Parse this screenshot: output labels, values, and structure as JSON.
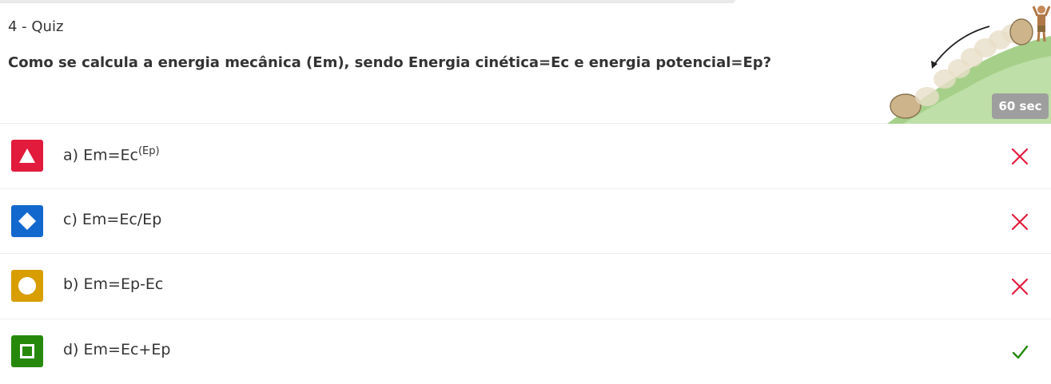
{
  "quiz": {
    "label": "4 - Quiz",
    "question": "Como se calcula a energia mecânica (Em), sendo Energia cinética=Ec e energia potencial=Ep?",
    "timer": "60 sec"
  },
  "answers": [
    {
      "prefix": "a) Em=Ec",
      "sup": "(Ep)",
      "shape": "triangle-icon",
      "color": "#e21b3c",
      "result": "incorrect"
    },
    {
      "prefix": "c) Em=Ec/Ep",
      "sup": "",
      "shape": "diamond-icon",
      "color": "#1368ce",
      "result": "incorrect"
    },
    {
      "prefix": "b) Em=Ep-Ec",
      "sup": "",
      "shape": "circle-icon",
      "color": "#d89e00",
      "result": "incorrect"
    },
    {
      "prefix": "d) Em=Ec+Ep",
      "sup": "",
      "shape": "square-icon",
      "color": "#26890c",
      "result": "correct"
    }
  ],
  "colors": {
    "incorrect_mark": "#e21b3c",
    "correct_mark": "#26890c",
    "timer_bg": "#9e9e9e"
  }
}
